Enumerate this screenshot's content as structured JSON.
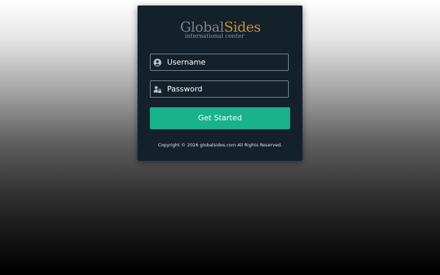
{
  "logo": {
    "word_part1": "Global",
    "word_part2": "Sides",
    "tagline": "international center"
  },
  "form": {
    "username": {
      "placeholder": "Username",
      "icon": "user-circle-icon",
      "value": ""
    },
    "password": {
      "placeholder": "Password",
      "icon": "user-lock-icon",
      "value": ""
    },
    "submit_label": "Get Started"
  },
  "footer": {
    "copyright": "Copyright © 2026 globalsides.com All Rights Reserved."
  },
  "colors": {
    "card_background": "#14212b",
    "button": "#1ab28a",
    "logo_gray": "#7f8488",
    "logo_gold": "#c9922e",
    "field_border": "#7c8a93"
  }
}
